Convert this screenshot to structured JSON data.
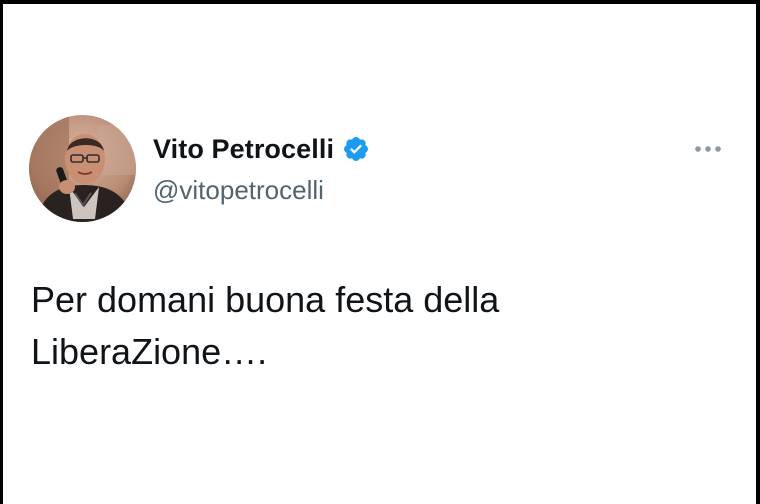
{
  "tweet": {
    "author": {
      "display_name": "Vito Petrocelli",
      "handle": "@vitopetrocelli",
      "verified": true,
      "avatar_icon": "profile-photo"
    },
    "text": "Per domani buona festa della\nLiberaZione….",
    "more_icon": "more-options-icon"
  },
  "colors": {
    "text_primary": "#0f1419",
    "text_secondary": "#536471",
    "verified_badge": "#1d9bf0",
    "background": "#ffffff"
  }
}
